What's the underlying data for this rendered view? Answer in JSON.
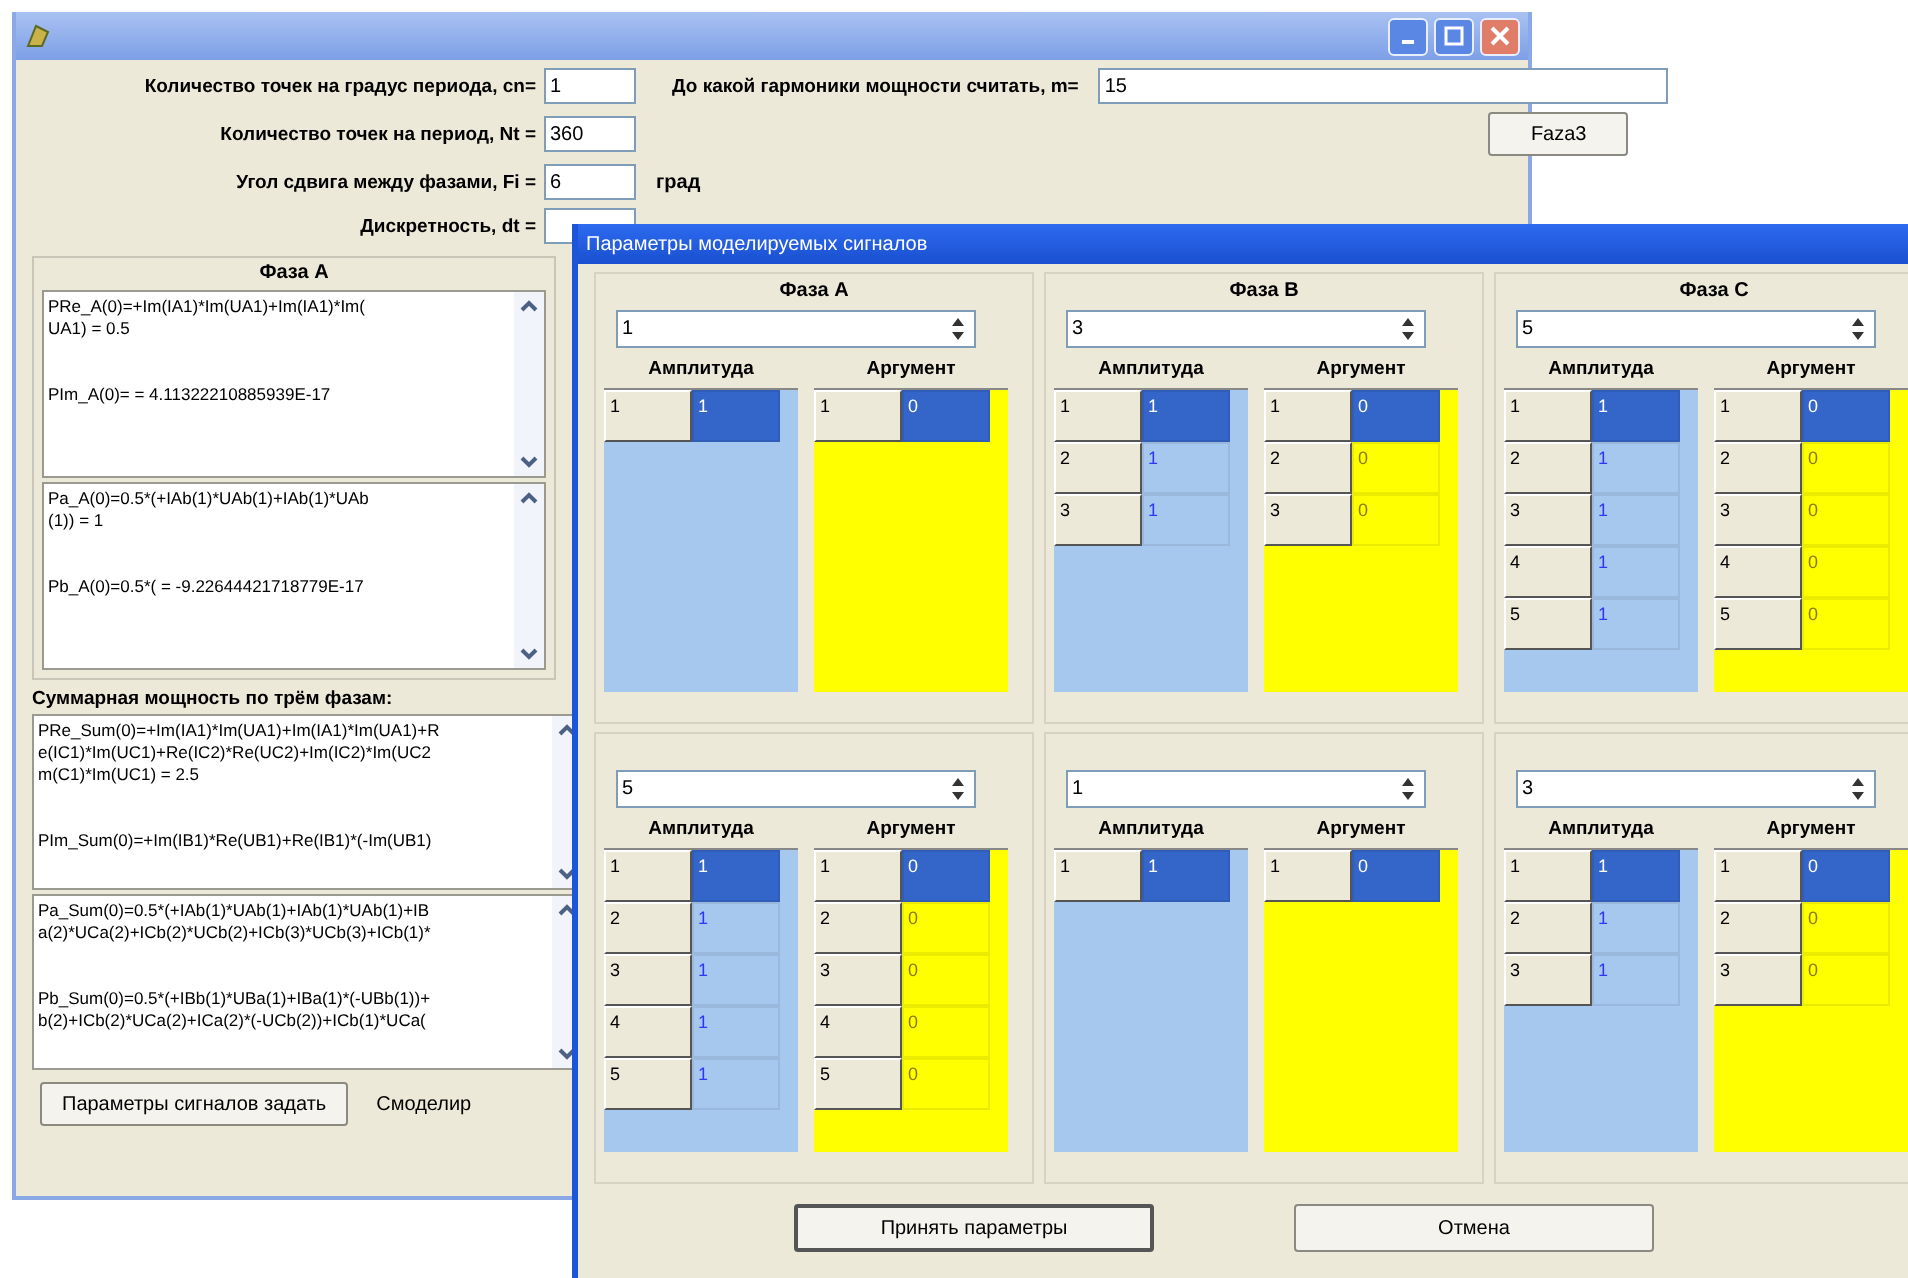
{
  "main_window": {
    "params": [
      {
        "label": "Количество точек на градус периода, cn=",
        "value": "1"
      },
      {
        "label": "Количество точек на период, Nt =",
        "value": "360"
      },
      {
        "label": "Угол сдвига между фазами, Fi =",
        "value": "6",
        "unit": "град"
      },
      {
        "label": "Дискретность, dt ="
      }
    ],
    "harmonic": {
      "label": "До какой гармоники мощности считать, m=",
      "value": "15"
    },
    "phase_button": "Faza3",
    "phase_group": {
      "title": "Фаза A",
      "memos": [
        {
          "paragraphs": [
            [
              "PRe_A(0)=+Im(IA1)*Im(UA1)+Im(IA1)*Im(",
              "UA1) = 0.5"
            ],
            [
              "PIm_A(0)= = 4.11322210885939E-17"
            ]
          ]
        },
        {
          "paragraphs": [
            [
              "Pa_A(0)=0.5*(+IAb(1)*UAb(1)+IAb(1)*UAb",
              "(1)) = 1"
            ],
            [
              "Pb_A(0)=0.5*( = -9.22644421718779E-17"
            ]
          ]
        }
      ]
    },
    "sum": {
      "title": "Суммарная мощность по трём фазам:",
      "memos": [
        {
          "paragraphs": [
            [
              "PRe_Sum(0)=+Im(IA1)*Im(UA1)+Im(IA1)*Im(UA1)+R",
              "e(IC1)*Im(UC1)+Re(IC2)*Re(UC2)+Im(IC2)*Im(UC2",
              "m(C1)*Im(UC1) = 2.5"
            ],
            [
              "PIm_Sum(0)=+Im(IB1)*Re(UB1)+Re(IB1)*(-Im(UB1)"
            ]
          ]
        },
        {
          "paragraphs": [
            [
              "Pa_Sum(0)=0.5*(+IAb(1)*UAb(1)+IAb(1)*UAb(1)+IB",
              "a(2)*UCa(2)+ICb(2)*UCb(2)+ICb(3)*UCb(3)+ICb(1)*"
            ],
            [
              "Pb_Sum(0)=0.5*(+IBb(1)*UBa(1)+IBa(1)*(-UBb(1))+",
              "b(2)+ICb(2)*UCa(2)+ICa(2)*(-UCb(2))+ICb(1)*UCa("
            ]
          ]
        }
      ]
    },
    "buttons": [
      "Параметры сигналов задать",
      "Смоделир"
    ]
  },
  "dialog": {
    "title": "Параметры моделируемых сигналов",
    "groups": [
      {
        "title": "Фаза A",
        "spin": "1",
        "amplitude_label": "Амплитуда",
        "argument_label": "Аргумент",
        "amplitude_rows": [
          {
            "index": "1",
            "value": "1",
            "selected": true
          }
        ],
        "argument_rows": [
          {
            "index": "1",
            "value": "0",
            "selected": true
          }
        ]
      },
      {
        "title": "Фаза B",
        "spin": "3",
        "amplitude_label": "Амплитуда",
        "argument_label": "Аргумент",
        "amplitude_rows": [
          {
            "index": "1",
            "value": "1",
            "selected": true
          },
          {
            "index": "2",
            "value": "1",
            "selected": false
          },
          {
            "index": "3",
            "value": "1",
            "selected": false
          }
        ],
        "argument_rows": [
          {
            "index": "1",
            "value": "0",
            "selected": true
          },
          {
            "index": "2",
            "value": "0",
            "selected": false
          },
          {
            "index": "3",
            "value": "0",
            "selected": false
          }
        ]
      },
      {
        "title": "Фаза C",
        "spin": "5",
        "amplitude_label": "Амплитуда",
        "argument_label": "Аргумент",
        "amplitude_rows": [
          {
            "index": "1",
            "value": "1",
            "selected": true
          },
          {
            "index": "2",
            "value": "1",
            "selected": false
          },
          {
            "index": "3",
            "value": "1",
            "selected": false
          },
          {
            "index": "4",
            "value": "1",
            "selected": false
          },
          {
            "index": "5",
            "value": "1",
            "selected": false
          }
        ],
        "argument_rows": [
          {
            "index": "1",
            "value": "0",
            "selected": true
          },
          {
            "index": "2",
            "value": "0",
            "selected": false
          },
          {
            "index": "3",
            "value": "0",
            "selected": false
          },
          {
            "index": "4",
            "value": "0",
            "selected": false
          },
          {
            "index": "5",
            "value": "0",
            "selected": false
          }
        ]
      },
      {
        "spin": "5",
        "amplitude_label": "Амплитуда",
        "argument_label": "Аргумент",
        "amplitude_rows": [
          {
            "index": "1",
            "value": "1",
            "selected": true
          },
          {
            "index": "2",
            "value": "1",
            "selected": false
          },
          {
            "index": "3",
            "value": "1",
            "selected": false
          },
          {
            "index": "4",
            "value": "1",
            "selected": false
          },
          {
            "index": "5",
            "value": "1",
            "selected": false
          }
        ],
        "argument_rows": [
          {
            "index": "1",
            "value": "0",
            "selected": true
          },
          {
            "index": "2",
            "value": "0",
            "selected": false
          },
          {
            "index": "3",
            "value": "0",
            "selected": false
          },
          {
            "index": "4",
            "value": "0",
            "selected": false
          },
          {
            "index": "5",
            "value": "0",
            "selected": false
          }
        ]
      },
      {
        "spin": "1",
        "amplitude_label": "Амплитуда",
        "argument_label": "Аргумент",
        "amplitude_rows": [
          {
            "index": "1",
            "value": "1",
            "selected": true
          }
        ],
        "argument_rows": [
          {
            "index": "1",
            "value": "0",
            "selected": true
          }
        ]
      },
      {
        "spin": "3",
        "amplitude_label": "Амплитуда",
        "argument_label": "Аргумент",
        "amplitude_rows": [
          {
            "index": "1",
            "value": "1",
            "selected": true
          },
          {
            "index": "2",
            "value": "1",
            "selected": false
          },
          {
            "index": "3",
            "value": "1",
            "selected": false
          }
        ],
        "argument_rows": [
          {
            "index": "1",
            "value": "0",
            "selected": true
          },
          {
            "index": "2",
            "value": "0",
            "selected": false
          },
          {
            "index": "3",
            "value": "0",
            "selected": false
          }
        ]
      }
    ],
    "buttons": [
      {
        "label": "Принять параметры",
        "default": true
      },
      {
        "label": "Отмена",
        "default": false
      }
    ]
  }
}
